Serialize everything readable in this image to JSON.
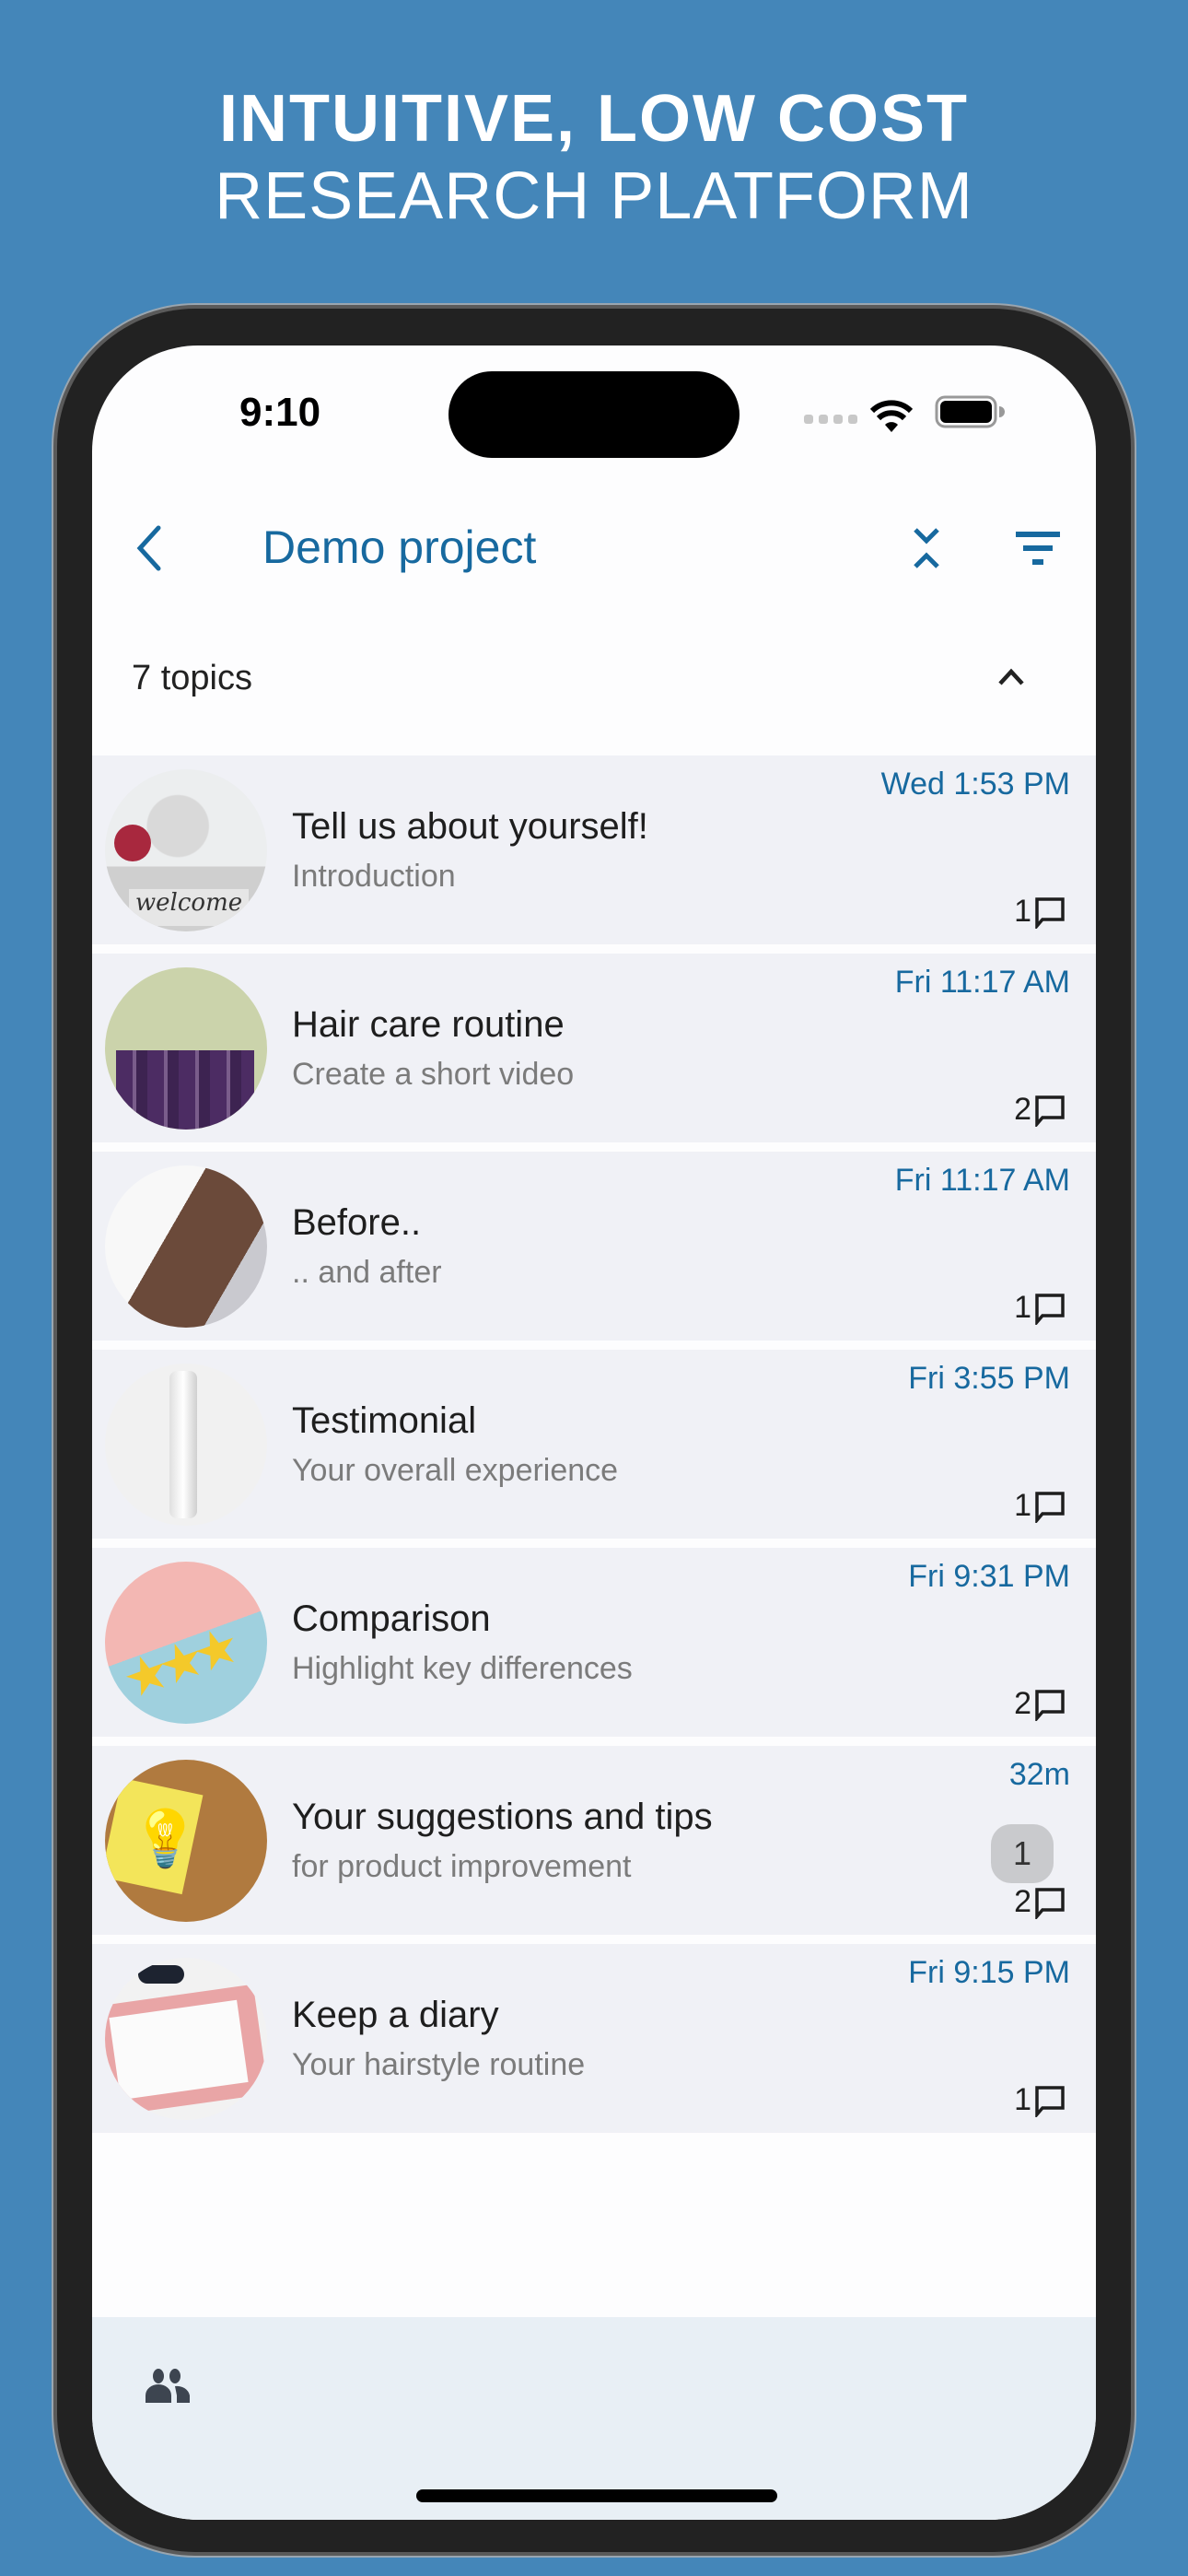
{
  "promo": {
    "cutoff_text": "",
    "headline_line1": "INTUITIVE, LOW COST",
    "headline_line2": "RESEARCH PLATFORM",
    "background_color": "#4486b9"
  },
  "status_bar": {
    "time": "9:10",
    "icons": [
      "cellular-signal-icon",
      "wifi-icon",
      "battery-icon"
    ]
  },
  "header": {
    "back_icon": "chevron-left-icon",
    "title": "Demo project",
    "collapse_icon": "collapse-all-icon",
    "filter_icon": "filter-icon",
    "accent_color": "#17699f"
  },
  "topics_section": {
    "count_label": "7 topics",
    "toggle_icon": "chevron-up-icon"
  },
  "topics": [
    {
      "title": "Tell us about yourself!",
      "subtitle": "Introduction",
      "time": "Wed 1:53 PM",
      "comments": "1",
      "unread": null,
      "thumb": "welcome-sign-photo"
    },
    {
      "title": "Hair care routine",
      "subtitle": "Create a short video",
      "time": "Fri 11:17 AM",
      "comments": "2",
      "unread": null,
      "thumb": "purple-bottles-photo"
    },
    {
      "title": "Before..",
      "subtitle": ".. and after",
      "time": "Fri 11:17 AM",
      "comments": "1",
      "unread": null,
      "thumb": "hair-photo"
    },
    {
      "title": "Testimonial",
      "subtitle": "Your overall experience",
      "time": "Fri 3:55 PM",
      "comments": "1",
      "unread": null,
      "thumb": "product-tube-photo"
    },
    {
      "title": "Comparison",
      "subtitle": "Highlight key differences",
      "time": "Fri 9:31 PM",
      "comments": "2",
      "unread": null,
      "thumb": "stars-photo"
    },
    {
      "title": "Your suggestions and tips",
      "subtitle": "for product improvement",
      "time": "32m",
      "comments": "2",
      "unread": "1",
      "thumb": "lightbulb-note-photo"
    },
    {
      "title": "Keep a diary",
      "subtitle": "Your hairstyle routine",
      "time": "Fri 9:15 PM",
      "comments": "1",
      "unread": null,
      "thumb": "planner-photo"
    }
  ],
  "bottom_bar": {
    "icon": "people-icon"
  }
}
